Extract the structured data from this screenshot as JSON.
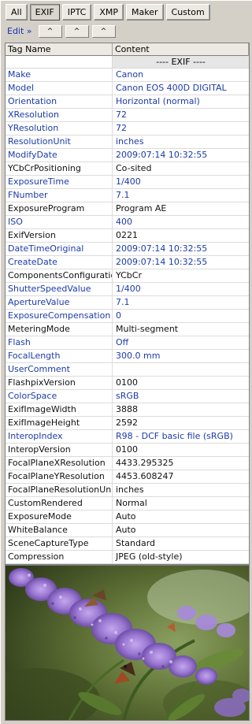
{
  "tabs": [
    {
      "label": "All",
      "active": false
    },
    {
      "label": "EXIF",
      "active": true
    },
    {
      "label": "IPTC",
      "active": false
    },
    {
      "label": "XMP",
      "active": false
    },
    {
      "label": "Maker",
      "active": false
    },
    {
      "label": "Custom",
      "active": false
    }
  ],
  "edit": {
    "label": "Edit »",
    "arrow": "^"
  },
  "table": {
    "header_tag": "Tag Name",
    "header_content": "Content",
    "section_label": "---- EXIF ----",
    "rows": [
      {
        "tag": "Make",
        "value": "Canon",
        "style": "blue"
      },
      {
        "tag": "Model",
        "value": "Canon EOS 400D DIGITAL",
        "style": "blue"
      },
      {
        "tag": "Orientation",
        "value": "Horizontal (normal)",
        "style": "blue"
      },
      {
        "tag": "XResolution",
        "value": "72",
        "style": "blue"
      },
      {
        "tag": "YResolution",
        "value": "72",
        "style": "blue"
      },
      {
        "tag": "ResolutionUnit",
        "value": "inches",
        "style": "blue"
      },
      {
        "tag": "ModifyDate",
        "value": "2009:07:14 10:32:55",
        "style": "blue"
      },
      {
        "tag": "YCbCrPositioning",
        "value": "Co-sited",
        "style": "black"
      },
      {
        "tag": "ExposureTime",
        "value": "1/400",
        "style": "blue"
      },
      {
        "tag": "FNumber",
        "value": "7.1",
        "style": "blue"
      },
      {
        "tag": "ExposureProgram",
        "value": "Program AE",
        "style": "black"
      },
      {
        "tag": "ISO",
        "value": "400",
        "style": "blue"
      },
      {
        "tag": "ExifVersion",
        "value": "0221",
        "style": "black"
      },
      {
        "tag": "DateTimeOriginal",
        "value": "2009:07:14 10:32:55",
        "style": "blue"
      },
      {
        "tag": "CreateDate",
        "value": "2009:07:14 10:32:55",
        "style": "blue"
      },
      {
        "tag": "ComponentsConfiguration",
        "value": "YCbCr",
        "style": "black"
      },
      {
        "tag": "ShutterSpeedValue",
        "value": "1/400",
        "style": "blue"
      },
      {
        "tag": "ApertureValue",
        "value": "7.1",
        "style": "blue"
      },
      {
        "tag": "ExposureCompensation",
        "value": "0",
        "style": "blue"
      },
      {
        "tag": "MeteringMode",
        "value": "Multi-segment",
        "style": "black"
      },
      {
        "tag": "Flash",
        "value": "Off",
        "style": "blue"
      },
      {
        "tag": "FocalLength",
        "value": "300.0 mm",
        "style": "blue"
      },
      {
        "tag": "UserComment",
        "value": "",
        "style": "blue"
      },
      {
        "tag": "FlashpixVersion",
        "value": "0100",
        "style": "black"
      },
      {
        "tag": "ColorSpace",
        "value": "sRGB",
        "style": "blue"
      },
      {
        "tag": "ExifImageWidth",
        "value": "3888",
        "style": "black"
      },
      {
        "tag": "ExifImageHeight",
        "value": "2592",
        "style": "black"
      },
      {
        "tag": "InteropIndex",
        "value": "R98 - DCF basic file (sRGB)",
        "style": "blue"
      },
      {
        "tag": "InteropVersion",
        "value": "0100",
        "style": "black"
      },
      {
        "tag": "FocalPlaneXResolution",
        "value": "4433.295325",
        "style": "black"
      },
      {
        "tag": "FocalPlaneYResolution",
        "value": "4453.608247",
        "style": "black"
      },
      {
        "tag": "FocalPlaneResolutionUnit",
        "value": "inches",
        "style": "black"
      },
      {
        "tag": "CustomRendered",
        "value": "Normal",
        "style": "black"
      },
      {
        "tag": "ExposureMode",
        "value": "Auto",
        "style": "black"
      },
      {
        "tag": "WhiteBalance",
        "value": "Auto",
        "style": "black"
      },
      {
        "tag": "SceneCaptureType",
        "value": "Standard",
        "style": "black"
      },
      {
        "tag": "Compression",
        "value": "JPEG (old-style)",
        "style": "black"
      }
    ]
  },
  "colors": {
    "panel": "#d4d0c8",
    "tag_blue": "#1c3ba8",
    "tag_black": "#111111",
    "section_bg": "#e6e6e6",
    "link": "#1a35b0"
  }
}
